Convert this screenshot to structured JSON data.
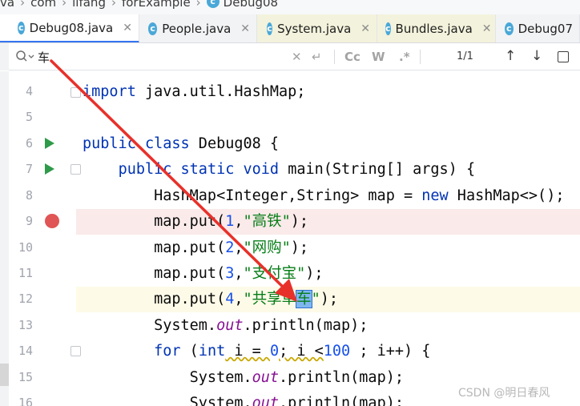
{
  "breadcrumb": {
    "items": [
      "va",
      "com",
      "lifang",
      "forExample"
    ],
    "class_name": "Debug08",
    "class_icon_letter": "c"
  },
  "tabs": [
    {
      "label": "Debug08.java",
      "icon_letter": "c",
      "active": true,
      "close": "✕"
    },
    {
      "label": "People.java",
      "icon_letter": "c",
      "active": false,
      "close": "✕"
    },
    {
      "label": "System.java",
      "icon_letter": "c",
      "active": false,
      "close": "✕"
    },
    {
      "label": "Bundles.java",
      "icon_letter": "c",
      "active": false,
      "close": "✕"
    },
    {
      "label": "Debug07",
      "icon_letter": "c",
      "active": false,
      "close": ""
    }
  ],
  "find": {
    "query": "车",
    "match_count": "1/1",
    "case_label": "Cc",
    "word_label": "W",
    "regex_label": ".*"
  },
  "editor": {
    "lines": [
      {
        "num": "4"
      },
      {
        "num": "5"
      },
      {
        "num": "6"
      },
      {
        "num": "7"
      },
      {
        "num": "8"
      },
      {
        "num": "9"
      },
      {
        "num": "10"
      },
      {
        "num": "11"
      },
      {
        "num": "12"
      },
      {
        "num": "13"
      },
      {
        "num": "14"
      },
      {
        "num": "15"
      },
      {
        "num": "16"
      }
    ],
    "code": {
      "l4_a": "import",
      "l4_b": " java.util.HashMap;",
      "l6_a": "public",
      "l6_b": " ",
      "l6_c": "class",
      "l6_d": " Debug08 {",
      "l7_a": "    ",
      "l7_b": "public",
      "l7_c": " ",
      "l7_d": "static",
      "l7_e": " ",
      "l7_f": "void",
      "l7_g": " main(String[] args) {",
      "l8_a": "        HashMap<Integer,String> map = ",
      "l8_b": "new",
      "l8_c": " HashMap<>();",
      "l9_a": "        map.put(",
      "l9_b": "1",
      "l9_c": ",",
      "l9_d": "\"高铁\"",
      "l9_e": ");",
      "l10_a": "        map.put(",
      "l10_b": "2",
      "l10_c": ",",
      "l10_d": "\"网购\"",
      "l10_e": ");",
      "l11_a": "        map.put(",
      "l11_b": "3",
      "l11_c": ",",
      "l11_d": "\"支付宝\"",
      "l11_e": ");",
      "l12_a": "        map.put(",
      "l12_b": "4",
      "l12_c": ",",
      "l12_d": "\"共享单",
      "l12_e": "车",
      "l12_f": "\"",
      "l12_g": ");",
      "l13_a": "        System.",
      "l13_b": "out",
      "l13_c": ".println(map);",
      "l14_a": "        ",
      "l14_b": "for",
      "l14_c": " (",
      "l14_d": "int",
      "l14_e": " i = ",
      "l14_f": "0",
      "l14_g": "; i <",
      "l14_h": "100",
      "l14_i": " ; i++) {",
      "l15_a": "            System.",
      "l15_b": "out",
      "l15_c": ".println(map);",
      "l16_a": "            System.",
      "l16_b": "out",
      "l16_c": ".println(map);"
    }
  },
  "watermark": "CSDN @明日春风",
  "colors": {
    "keyword": "#0033b3",
    "string": "#067d17",
    "number": "#1750eb",
    "field": "#871094",
    "breakpoint": "#e05555",
    "run": "#2e9a4a",
    "annotation_arrow": "#e8302a"
  }
}
